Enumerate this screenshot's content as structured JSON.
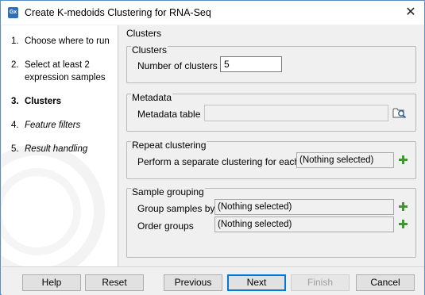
{
  "window": {
    "title": "Create K-medoids Clustering for RNA-Seq",
    "app_icon_text": "Gx",
    "close_glyph": "✕"
  },
  "steps": [
    {
      "num": "1.",
      "label": "Choose where to run",
      "state": "done"
    },
    {
      "num": "2.",
      "label": "Select at least 2 expression samples",
      "state": "done"
    },
    {
      "num": "3.",
      "label": "Clusters",
      "state": "current"
    },
    {
      "num": "4.",
      "label": "Feature filters",
      "state": "future"
    },
    {
      "num": "5.",
      "label": "Result handling",
      "state": "future"
    }
  ],
  "main": {
    "section_title": "Clusters",
    "clusters_group": {
      "legend": "Clusters",
      "number_label": "Number of clusters",
      "number_value": "5"
    },
    "metadata_group": {
      "legend": "Metadata",
      "table_label": "Metadata table",
      "table_value": "",
      "browse_icon": "folder-browse-icon"
    },
    "repeat_group": {
      "legend": "Repeat clustering",
      "label": "Perform a separate clustering for each",
      "value": "(Nothing selected)"
    },
    "grouping_group": {
      "legend": "Sample grouping",
      "group_label": "Group samples by",
      "group_value": "(Nothing selected)",
      "order_label": "Order groups",
      "order_value": "(Nothing selected)"
    }
  },
  "footer": {
    "help": "Help",
    "reset": "Reset",
    "previous": "Previous",
    "next": "Next",
    "finish": "Finish",
    "cancel": "Cancel"
  },
  "colors": {
    "accent": "#0078d7",
    "plus_green": "#3c9a2c"
  }
}
